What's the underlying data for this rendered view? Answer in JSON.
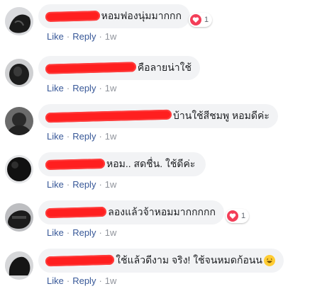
{
  "comments": [
    {
      "text": "หอมฟองนุ่มมากกก",
      "reaction_count": "1",
      "like": "Like",
      "reply": "Reply",
      "time": "1w"
    },
    {
      "text": "คือลายน่าใช้",
      "like": "Like",
      "reply": "Reply",
      "time": "1w"
    },
    {
      "text": "บ้านใช้สีชมพู หอมดีค่ะ",
      "like": "Like",
      "reply": "Reply",
      "time": "1w"
    },
    {
      "text": "หอม.. สดชื่น. ใช้ดีค่ะ",
      "like": "Like",
      "reply": "Reply",
      "time": "1w"
    },
    {
      "text": "ลองแล้วจ้าหอมมากกกกก",
      "reaction_count": "1",
      "like": "Like",
      "reply": "Reply",
      "time": "1w"
    },
    {
      "text": "ใช้แล้วดีงาม จริง! ใช้จนหมดก้อนน",
      "like": "Like",
      "reply": "Reply",
      "time": "1w"
    }
  ],
  "colors": {
    "link": "#385898",
    "muted": "#90949c",
    "bubble": "#f2f3f5",
    "redaction": "#ff1f1f",
    "heart": "#f33e58"
  },
  "icons": {
    "reaction": "heart-icon",
    "emoji": "grinning-face-icon"
  }
}
